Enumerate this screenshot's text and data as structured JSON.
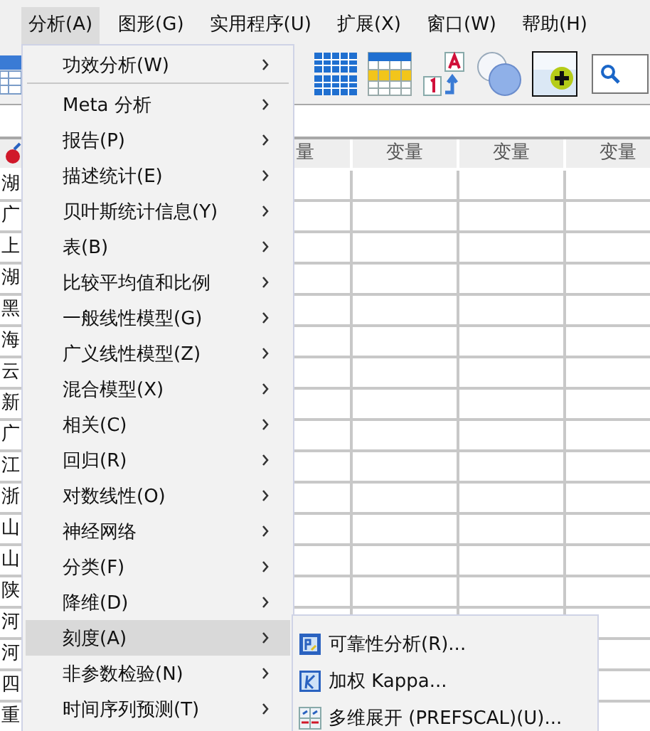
{
  "menubar": {
    "items": [
      {
        "label": "分析(A)",
        "selected": true
      },
      {
        "label": "图形(G)",
        "selected": false
      },
      {
        "label": "实用程序(U)",
        "selected": false
      },
      {
        "label": "扩展(X)",
        "selected": false
      },
      {
        "label": "窗口(W)",
        "selected": false
      },
      {
        "label": "帮助(H)",
        "selected": false
      }
    ]
  },
  "grid": {
    "columns": [
      {
        "header": "量"
      },
      {
        "header": "变量"
      },
      {
        "header": "变量"
      },
      {
        "header": "变量"
      }
    ],
    "rows": [
      {
        "name": "湖"
      },
      {
        "name": "广"
      },
      {
        "name": "上"
      },
      {
        "name": "湖"
      },
      {
        "name": "黑"
      },
      {
        "name": "海"
      },
      {
        "name": "云"
      },
      {
        "name": "新"
      },
      {
        "name": "广"
      },
      {
        "name": "江"
      },
      {
        "name": "浙"
      },
      {
        "name": "山"
      },
      {
        "name": "山"
      },
      {
        "name": "陕"
      },
      {
        "name": "河"
      },
      {
        "name": "河"
      },
      {
        "name": "四"
      },
      {
        "name": "重"
      }
    ]
  },
  "menu": {
    "items": [
      {
        "kind": "item",
        "label": "功效分析(W)",
        "selected": false
      },
      {
        "kind": "separator"
      },
      {
        "kind": "item",
        "label": "Meta 分析",
        "selected": false
      },
      {
        "kind": "item",
        "label": "报告(P)",
        "selected": false
      },
      {
        "kind": "item",
        "label": "描述统计(E)",
        "selected": false
      },
      {
        "kind": "item",
        "label": "贝叶斯统计信息(Y)",
        "selected": false
      },
      {
        "kind": "item",
        "label": "表(B)",
        "selected": false
      },
      {
        "kind": "item",
        "label": "比较平均值和比例",
        "selected": false
      },
      {
        "kind": "item",
        "label": "一般线性模型(G)",
        "selected": false
      },
      {
        "kind": "item",
        "label": "广义线性模型(Z)",
        "selected": false
      },
      {
        "kind": "item",
        "label": "混合模型(X)",
        "selected": false
      },
      {
        "kind": "item",
        "label": "相关(C)",
        "selected": false
      },
      {
        "kind": "item",
        "label": "回归(R)",
        "selected": false
      },
      {
        "kind": "item",
        "label": "对数线性(O)",
        "selected": false
      },
      {
        "kind": "item",
        "label": "神经网络",
        "selected": false
      },
      {
        "kind": "item",
        "label": "分类(F)",
        "selected": false
      },
      {
        "kind": "item",
        "label": "降维(D)",
        "selected": false
      },
      {
        "kind": "item",
        "label": "刻度(A)",
        "selected": true
      },
      {
        "kind": "item",
        "label": "非参数检验(N)",
        "selected": false
      },
      {
        "kind": "item",
        "label": "时间序列预测(T)",
        "selected": false
      }
    ]
  },
  "submenu": {
    "items": [
      {
        "label": "可靠性分析(R)..."
      },
      {
        "label": "加权 Kappa..."
      },
      {
        "label": "多维展开 (PREFSCAL)(U)..."
      }
    ]
  }
}
